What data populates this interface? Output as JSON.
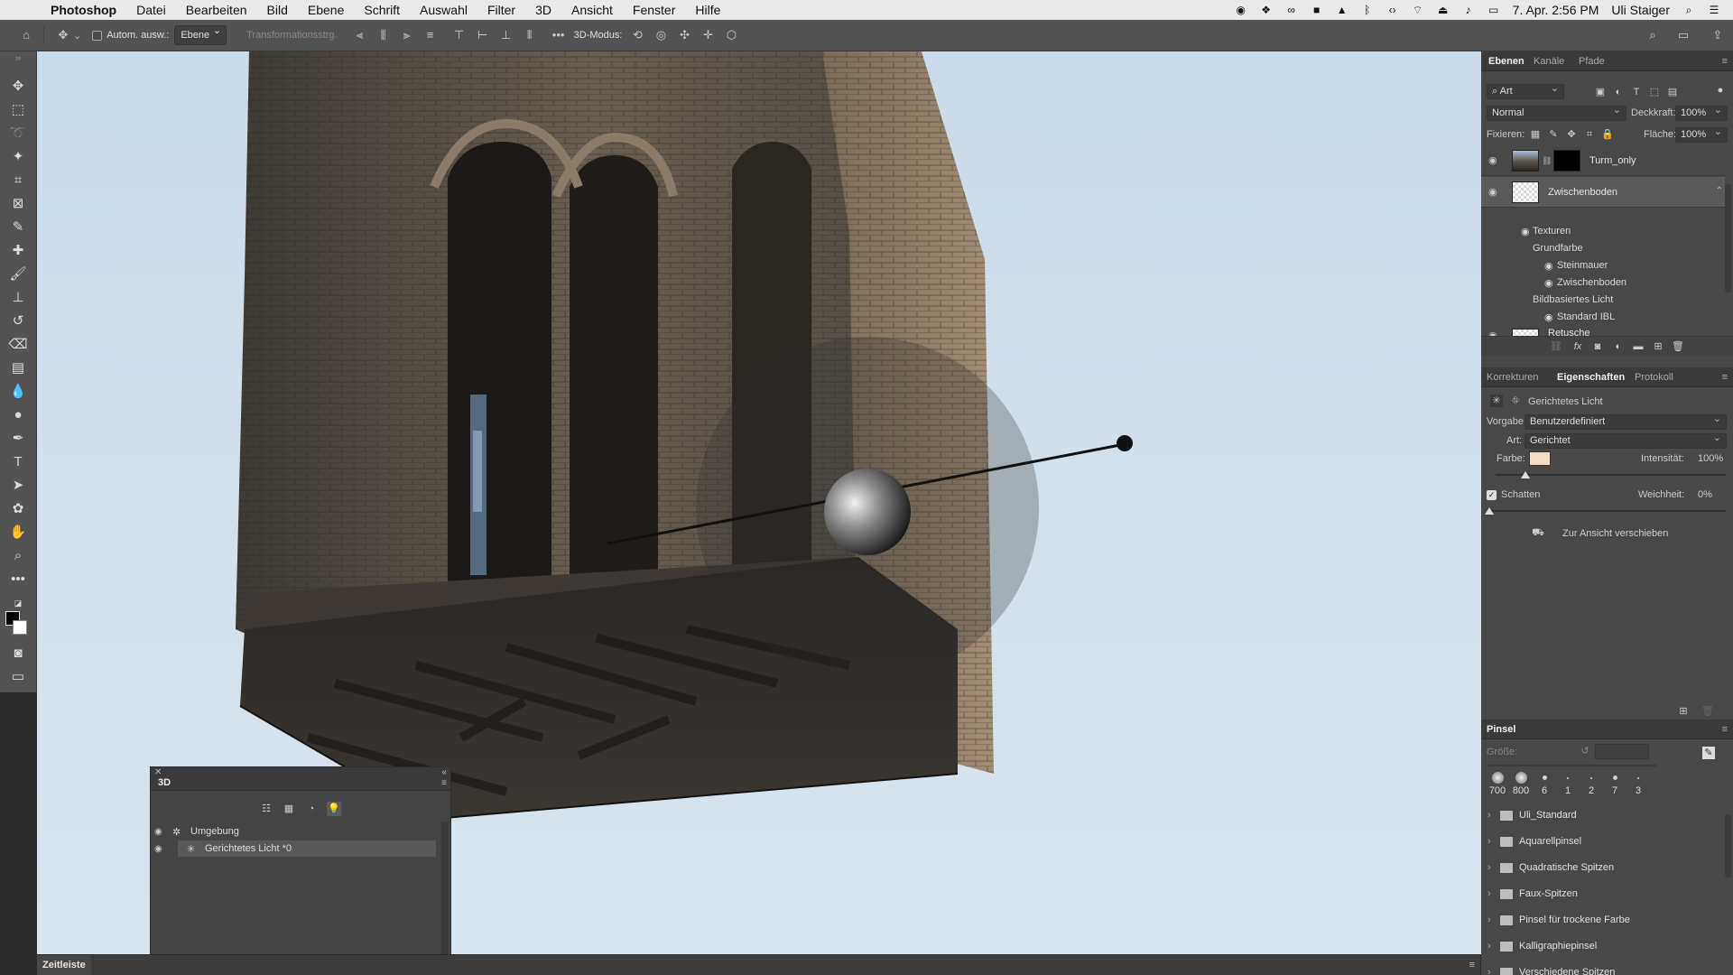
{
  "menubar": {
    "app": "Photoshop",
    "items": [
      "Datei",
      "Bearbeiten",
      "Bild",
      "Ebene",
      "Schrift",
      "Auswahl",
      "Filter",
      "3D",
      "Ansicht",
      "Fenster",
      "Hilfe"
    ],
    "datetime": "7. Apr.  2:56 PM",
    "user": "Uli Staiger"
  },
  "optionsbar": {
    "auto_select_label": "Autom. ausw.:",
    "auto_select_value": "Ebene",
    "transform_label": "Transformationsstrg.",
    "mode3d_label": "3D-Modus:"
  },
  "panel3d": {
    "title": "3D",
    "items": [
      {
        "label": "Umgebung"
      },
      {
        "label": "Gerichtetes Licht *0"
      }
    ]
  },
  "timeline": {
    "label": "Zeitleiste"
  },
  "layers_panel": {
    "tabs": [
      "Ebenen",
      "Kanäle",
      "Pfade"
    ],
    "filter_kind": "Art",
    "blend_mode": "Normal",
    "opacity_label": "Deckkraft:",
    "opacity_value": "100%",
    "lock_label": "Fixieren:",
    "fill_label": "Fläche:",
    "fill_value": "100%",
    "layers": [
      {
        "name": "Turm_only"
      },
      {
        "name": "Zwischenboden"
      },
      {
        "name": "Retusche"
      }
    ],
    "sublayers": {
      "textures": "Texturen",
      "base_color": "Grundfarbe",
      "tex1": "Steinmauer",
      "tex2": "Zwischenboden",
      "ibl": "Bildbasiertes Licht",
      "ibl_item": "Standard IBL"
    }
  },
  "properties_panel": {
    "tabs": [
      "Korrekturen",
      "Eigenschaften",
      "Protokoll"
    ],
    "header": "Gerichtetes Licht",
    "preset_label": "Vorgabe:",
    "preset_value": "Benutzerdefiniert",
    "type_label": "Art:",
    "type_value": "Gerichtet",
    "color_label": "Farbe:",
    "light_color": "#f3ddc6",
    "intensity_label": "Intensität:",
    "intensity_value": "100%",
    "shadow_label": "Schatten",
    "softness_label": "Weichheit:",
    "softness_value": "0%",
    "move_to_view": "Zur Ansicht verschieben"
  },
  "brush_panel": {
    "title": "Pinsel",
    "size_label": "Größe:",
    "recent": [
      "700",
      "800",
      "6",
      "1",
      "2",
      "7",
      "3"
    ],
    "folders": [
      "Uli_Standard",
      "Aquarellpinsel",
      "Quadratische Spitzen",
      "Faux-Spitzen",
      "Pinsel für trockene Farbe",
      "Kalligraphiepinsel",
      "Verschiedene Spitzen"
    ]
  },
  "colors": {
    "ui_bg": "#535353",
    "panel_bg": "#484848",
    "sky": "#d4e1ec",
    "stone": "#5a5148"
  }
}
